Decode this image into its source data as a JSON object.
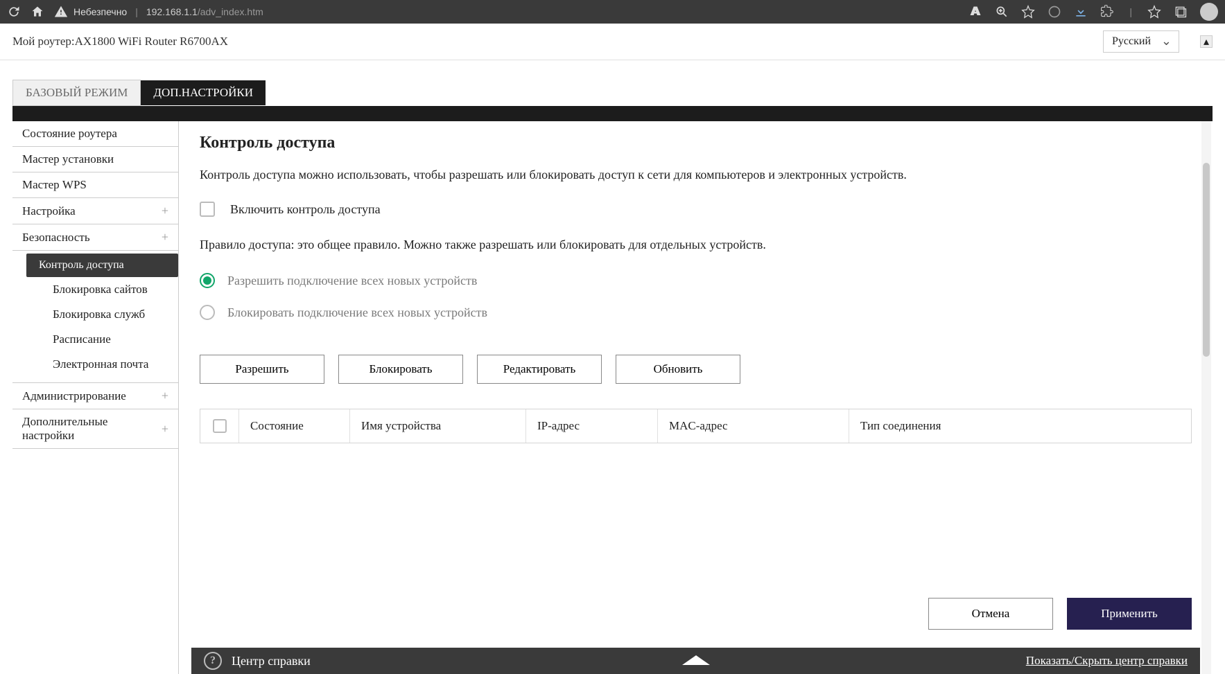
{
  "browser": {
    "insecure_label": "Небезпечно",
    "url_host": "192.168.1.1",
    "url_path": "/adv_index.htm"
  },
  "header": {
    "router_prefix": "Мой роутер:",
    "router_name": "AX1800 WiFi Router R6700AX",
    "language": "Русский"
  },
  "tabs": {
    "basic": "БАЗОВЫЙ РЕЖИМ",
    "advanced": "ДОП.НАСТРОЙКИ"
  },
  "sidebar": {
    "items": [
      {
        "label": "Состояние роутера",
        "expandable": false
      },
      {
        "label": "Мастер установки",
        "expandable": false
      },
      {
        "label": "Мастер WPS",
        "expandable": false
      },
      {
        "label": "Настройка",
        "expandable": true
      },
      {
        "label": "Безопасность",
        "expandable": true,
        "subitems": [
          {
            "label": "Контроль доступа",
            "active": true
          },
          {
            "label": "Блокировка сайтов"
          },
          {
            "label": "Блокировка служб"
          },
          {
            "label": "Расписание"
          },
          {
            "label": "Электронная почта"
          }
        ]
      },
      {
        "label": "Администрирование",
        "expandable": true
      },
      {
        "label": "Дополнительные настройки",
        "expandable": true
      }
    ]
  },
  "content": {
    "title": "Контроль доступа",
    "description": "Контроль доступа можно использовать, чтобы разрешать или блокировать доступ к сети для компьютеров и электронных устройств.",
    "enable_label": "Включить контроль доступа",
    "rule_desc": "Правило доступа: это общее правило. Можно также разрешать или блокировать для отдельных устройств.",
    "radio_allow": "Разрешить подключение всех новых устройств",
    "radio_block": "Блокировать подключение всех новых устройств",
    "buttons": {
      "allow": "Разрешить",
      "block": "Блокировать",
      "edit": "Редактировать",
      "refresh": "Обновить"
    },
    "table": {
      "columns": [
        "Состояние",
        "Имя устройства",
        "IP-адрес",
        "MAC-адрес",
        "Тип соединения"
      ]
    }
  },
  "footer": {
    "cancel": "Отмена",
    "apply": "Применить"
  },
  "helpbar": {
    "title": "Центр справки",
    "toggle": "Показать/Скрыть центр справки"
  }
}
